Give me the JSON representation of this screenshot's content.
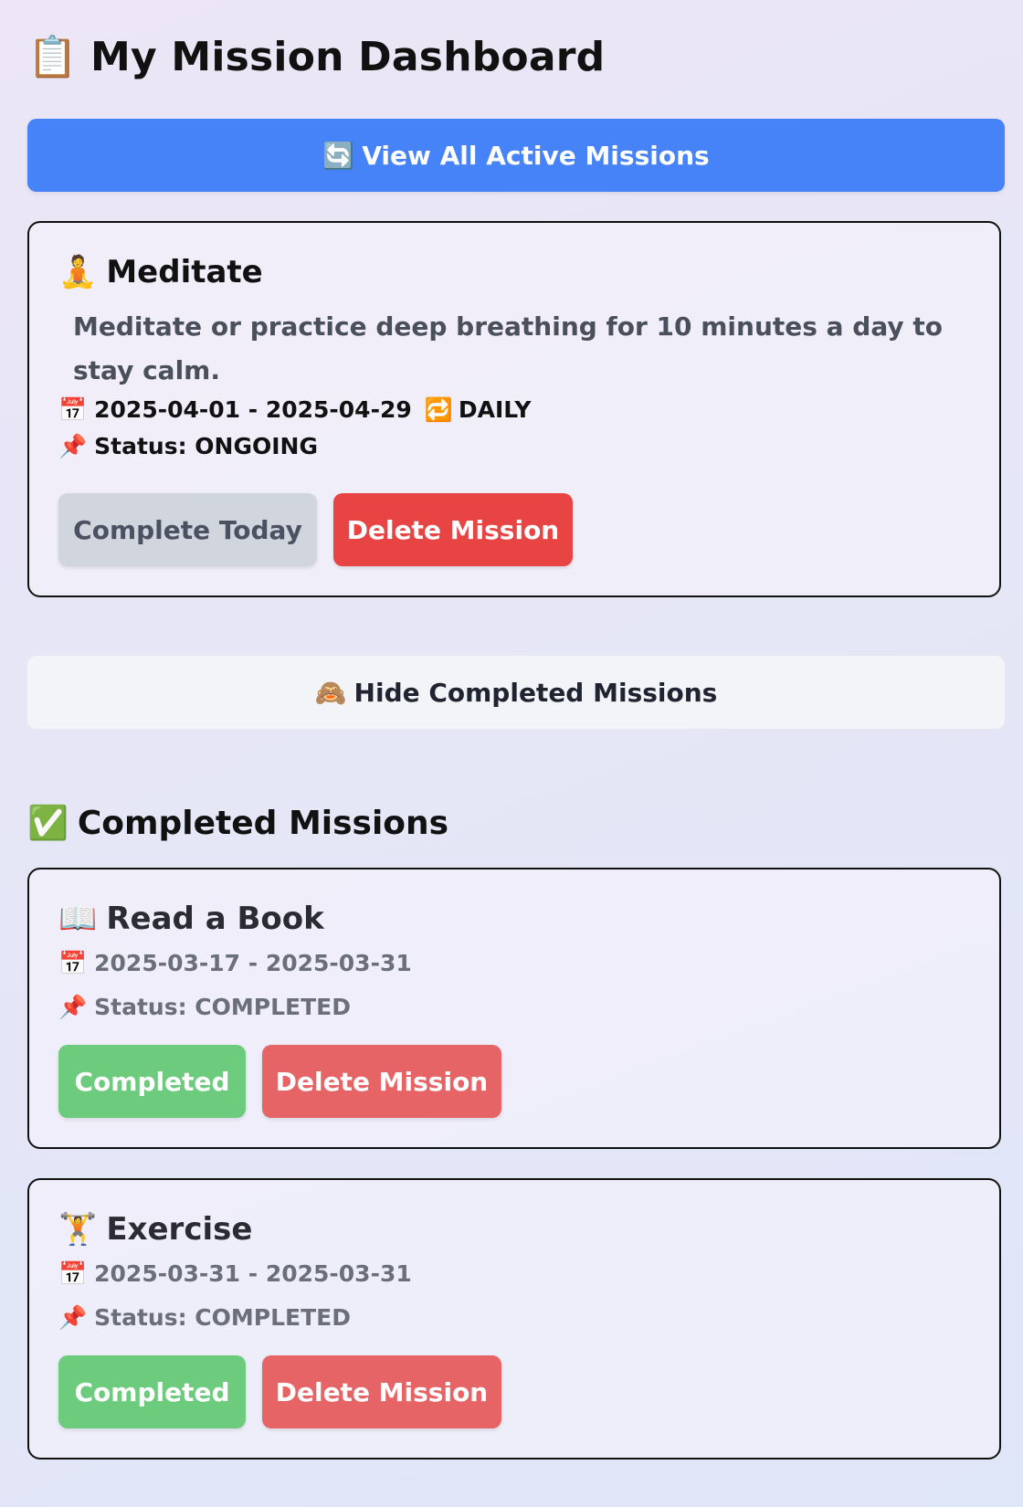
{
  "header": {
    "icon": "clipboard-icon",
    "icon_glyph": "📋",
    "title": "My Mission Dashboard"
  },
  "view_all_button": {
    "icon": "refresh-icon",
    "icon_glyph": "🔄",
    "label": "View All Active Missions"
  },
  "active_mission": {
    "icon": "meditation-icon",
    "icon_glyph": "🧘",
    "title": "Meditate",
    "description": "Meditate or practice deep breathing for 10 minutes a day to stay calm.",
    "calendar_glyph": "📅",
    "date_range": "2025-04-01 - 2025-04-29",
    "repeat_glyph": "🔁",
    "frequency": "DAILY",
    "pin_glyph": "📌",
    "status": "Status: ONGOING",
    "complete_label": "Complete Today",
    "delete_label": "Delete Mission"
  },
  "hide_completed_button": {
    "icon": "see-no-evil-monkey-icon",
    "icon_glyph": "🙈",
    "label": "Hide Completed Missions"
  },
  "completed_section": {
    "icon": "check-mark-icon",
    "icon_glyph": "✅",
    "title": "Completed Missions",
    "missions": [
      {
        "icon": "book-icon",
        "icon_glyph": "📖",
        "title": "Read a Book",
        "calendar_glyph": "📅",
        "date_range": "2025-03-17 - 2025-03-31",
        "pin_glyph": "📌",
        "status": "Status: COMPLETED",
        "completed_label": "Completed",
        "delete_label": "Delete Mission"
      },
      {
        "icon": "weightlifter-icon",
        "icon_glyph": "🏋️",
        "title": "Exercise",
        "calendar_glyph": "📅",
        "date_range": "2025-03-31 - 2025-03-31",
        "pin_glyph": "📌",
        "status": "Status: COMPLETED",
        "completed_label": "Completed",
        "delete_label": "Delete Mission"
      }
    ]
  },
  "colors": {
    "primary_blue": "#4682f8",
    "delete_red": "#e84444",
    "completed_green": "#6ccb7d",
    "muted_gray": "#d1d5dd"
  }
}
